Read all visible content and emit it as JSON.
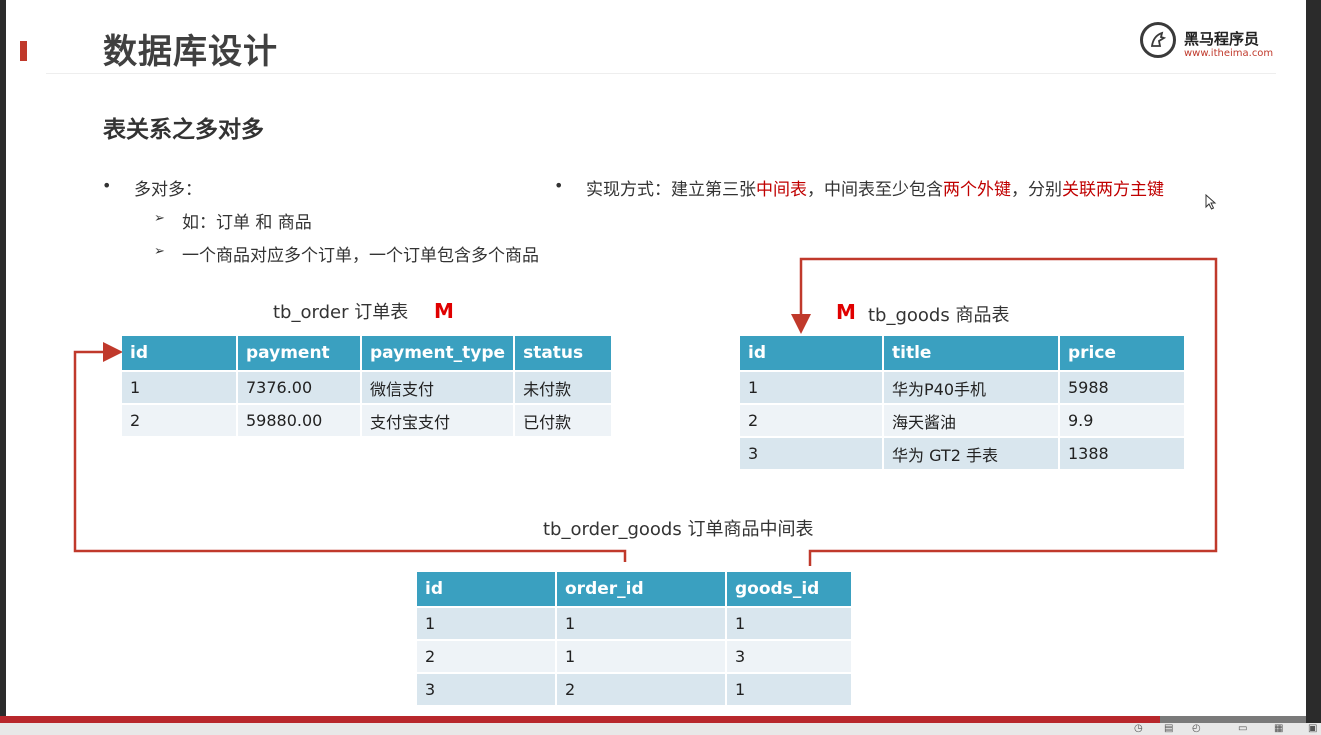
{
  "header": {
    "title": "数据库设计",
    "logo_name": "黑马程序员",
    "logo_url": "www.itheima.com"
  },
  "subtitle": "表关系之多对多",
  "bullets": {
    "left": {
      "main": "多对多：",
      "sub": [
        "如：订单 和 商品",
        "一个商品对应多个订单，一个订单包含多个商品"
      ]
    },
    "right": {
      "prefix": "实现方式：建立第三张",
      "highlight1": "中间表",
      "middle": "，中间表至少包含",
      "highlight2": "两个外键",
      "middle2": "，分别",
      "highlight3": "关联两方主键"
    }
  },
  "tables": {
    "order": {
      "caption": "tb_order 订单表",
      "mark": "M",
      "columns": [
        "id",
        "payment",
        "payment_type",
        "status"
      ],
      "rows": [
        [
          "1",
          "7376.00",
          "微信支付",
          "未付款"
        ],
        [
          "2",
          "59880.00",
          "支付宝支付",
          "已付款"
        ]
      ]
    },
    "goods": {
      "caption": "tb_goods 商品表",
      "mark": "M",
      "columns": [
        "id",
        "title",
        "price"
      ],
      "rows": [
        [
          "1",
          "华为P40手机",
          "5988"
        ],
        [
          "2",
          "海天酱油",
          "9.9"
        ],
        [
          "3",
          "华为 GT2 手表",
          "1388"
        ]
      ]
    },
    "order_goods": {
      "caption": "tb_order_goods 订单商品中间表",
      "columns": [
        "id",
        "order_id",
        "goods_id"
      ],
      "rows": [
        [
          "1",
          "1",
          "1"
        ],
        [
          "2",
          "1",
          "3"
        ],
        [
          "3",
          "2",
          "1"
        ]
      ]
    }
  },
  "colors": {
    "accent_red": "#c00000",
    "table_header": "#3aa0c0",
    "connector": "#c0392b"
  }
}
